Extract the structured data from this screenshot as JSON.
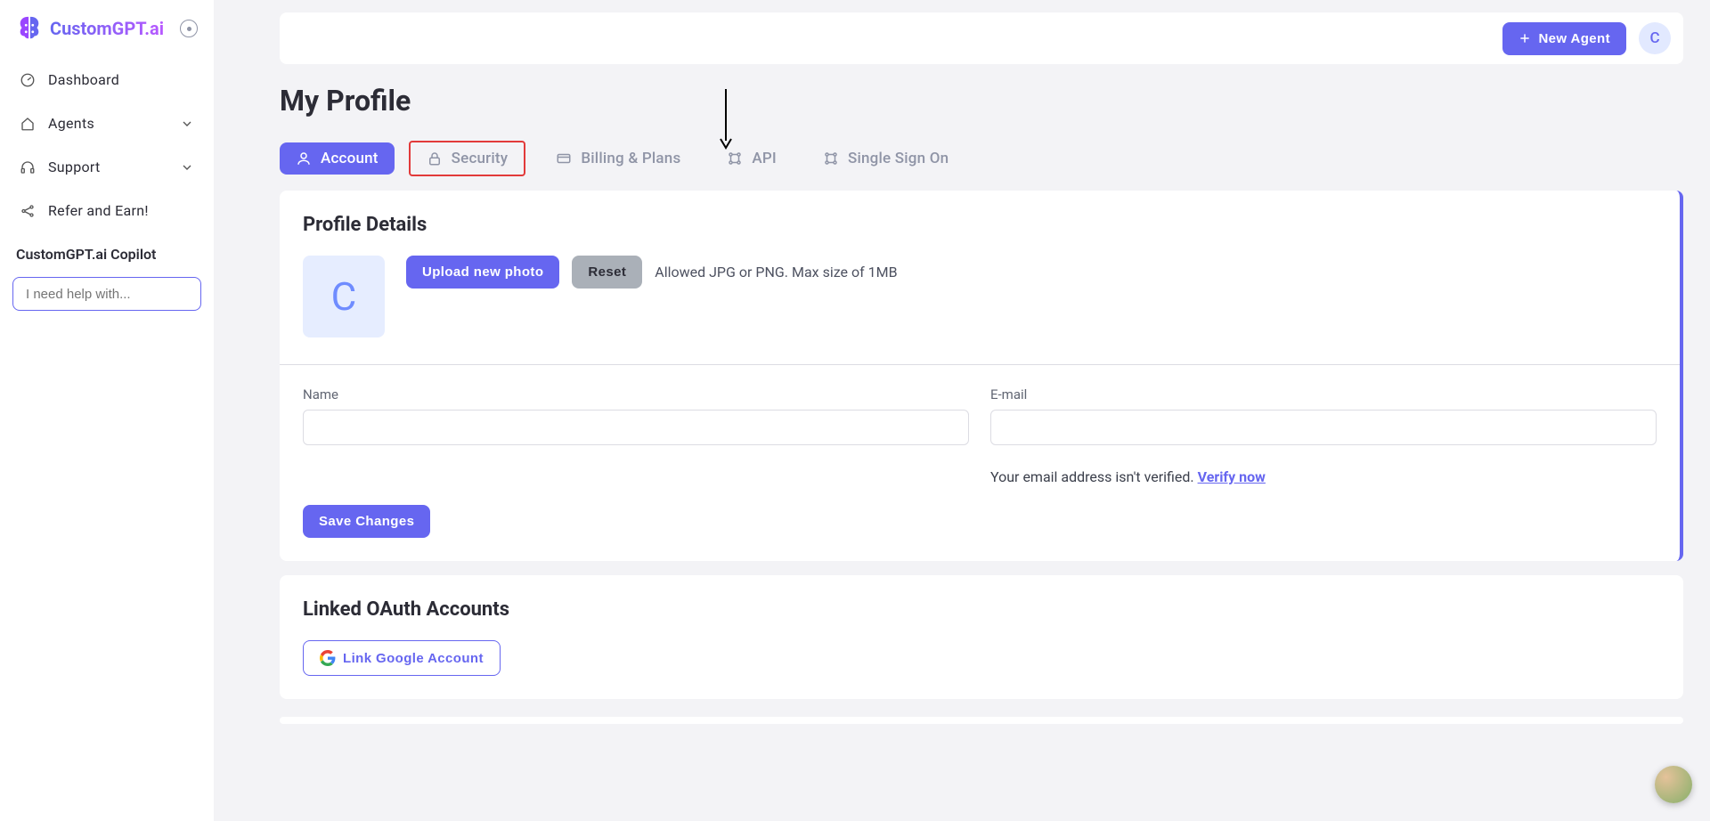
{
  "brand": {
    "name": "CustomGPT.ai",
    "avatar_initial": "C"
  },
  "sidebar": {
    "items": [
      {
        "label": "Dashboard"
      },
      {
        "label": "Agents"
      },
      {
        "label": "Support"
      },
      {
        "label": "Refer and Earn!"
      }
    ],
    "copilot_label": "CustomGPT.ai Copilot",
    "chat_placeholder": "I need help with..."
  },
  "topbar": {
    "new_agent": "New Agent"
  },
  "page_title": "My Profile",
  "tabs": [
    {
      "label": "Account"
    },
    {
      "label": "Security"
    },
    {
      "label": "Billing & Plans"
    },
    {
      "label": "API"
    },
    {
      "label": "Single Sign On"
    }
  ],
  "profile": {
    "section_title": "Profile Details",
    "upload_btn": "Upload new photo",
    "reset_btn": "Reset",
    "photo_note": "Allowed JPG or PNG. Max size of 1MB",
    "name_label": "Name",
    "name_value": "",
    "email_label": "E-mail",
    "email_value": "",
    "save_btn": "Save Changes",
    "verify_msg": "Your email address isn't verified. ",
    "verify_link": "Verify now"
  },
  "oauth": {
    "section_title": "Linked OAuth Accounts",
    "google_btn": "Link Google Account"
  }
}
